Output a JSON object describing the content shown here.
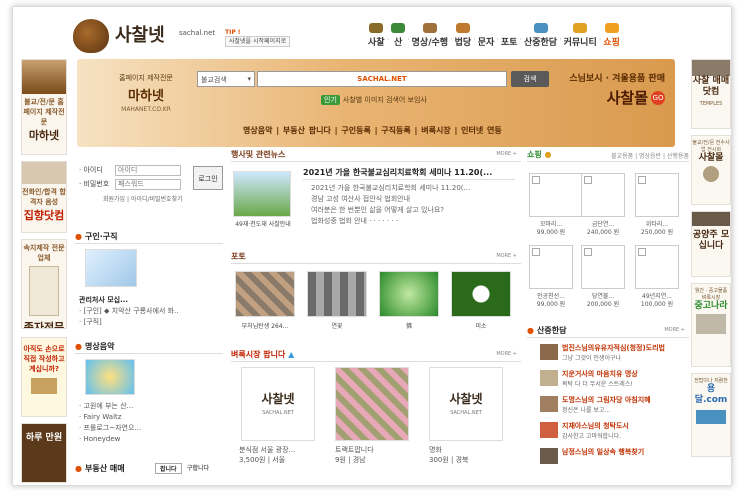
{
  "logo": {
    "name": "사찰넷",
    "domain": "sachal.net"
  },
  "tip": {
    "badge": "TIP !",
    "text": "사찰넷을 시작페이지로"
  },
  "topnav": [
    "사찰",
    "산",
    "명상/수행",
    "법당",
    "문자",
    "포토",
    "산중한담",
    "커뮤니티",
    "쇼핑"
  ],
  "banner": {
    "maha_small": "홈페이지 제작전문",
    "maha_big": "마하넷",
    "maha_domain": "MAHANET.CO.KR",
    "search_select": "불교검색",
    "search_value": "SACHAL.NET",
    "search_button": "검색",
    "popular_tag": "인기",
    "popular_text": "사찰별 이미지 검색어 보임사",
    "mall_small": "스님보시 · 겨울용품 판매",
    "mall_big": "사찰몰",
    "mall_go": "GO",
    "categories": "명상음악 | 부동산 팝니다 | 구인등록 | 구직등록 | 벼룩시장 | 인터넷 연등"
  },
  "left_ads": [
    {
      "small": "불교/전/문 홈페이지 제작전문",
      "big": "마하넷"
    },
    {
      "small": "전화인/합격 합격자 음성",
      "big": "집향닷컴"
    },
    {
      "small": "속지제작 전문업체",
      "big": "족자전문"
    },
    {
      "small": "아직도 손으로 직접 작성하고 계십니까?",
      "big": ""
    },
    {
      "small": "",
      "big": "하루 만원"
    }
  ],
  "login": {
    "id_label": "· 아이디",
    "pw_label": "· 비밀번호",
    "id_placeholder": "아이디",
    "pw_placeholder": "패스워드",
    "button": "로그인",
    "links": "회원가입 | 아이디/비밀번호찾기"
  },
  "jobs": {
    "title": "구인·구직",
    "items": [
      "관리처사 모십...",
      "· [구인] ◆ 치악산 구룡사에서 화..",
      "· [구직]"
    ]
  },
  "music": {
    "title": "명상음악",
    "items": [
      "· 고원에 부는 산...",
      "· Fairy Waltz",
      "· 프롤로그~자연으...",
      "· Honeydew"
    ]
  },
  "estate": {
    "title": "부동산 매매",
    "tab1": "팝니다",
    "tab2": "구합니다"
  },
  "news": {
    "title": "행사및 관련뉴스",
    "more": "MORE +",
    "head": "2021년 가을 한국불교심리치료학회 세미나 11.20(...",
    "caption": "49재·천도재 사찰안내",
    "body": [
      "2021년 가을 한국불교심리치료학회 세미나 11.20(...",
      "경남 고성 여산사 접안식 법회안내",
      "여러분은 한 번뿐인 삶을 어떻게 살고 있나요?",
      "법화성중 법회 안내 · · · · · · ·"
    ]
  },
  "photo": {
    "title": "포토",
    "more": "MORE +",
    "caps": [
      "부처님탄생 264...",
      "연꽃",
      "佛",
      "미소"
    ]
  },
  "market": {
    "title": "벼룩시장 팝니다",
    "more": "MORE +",
    "items": [
      {
        "big": "사찰넷",
        "small": "SACHAL.NET",
        "cap1": "분식점 서울 광장...",
        "cap2": "3,500원 | 서울"
      },
      {
        "big": "",
        "small": "",
        "cap1": "트랙트팝니다",
        "cap2": "9원 | 경남"
      },
      {
        "big": "사찰넷",
        "small": "SACHAL.NET",
        "cap1": "명화",
        "cap2": "300원 | 경북"
      }
    ]
  },
  "shop": {
    "title": "쇼핑",
    "links": "불교용품 | 명상음반 | 산행용품",
    "row1": [
      {
        "name": "꼬마리...",
        "price": "99,000 원"
      },
      {
        "name": "금단연...",
        "price": "240,000 원"
      },
      {
        "name": "위타리...",
        "price": "250,000 원"
      }
    ],
    "row2": [
      {
        "name": "인공천선...",
        "price": "99,000 원"
      },
      {
        "name": "당연불...",
        "price": "200,000 원"
      },
      {
        "name": "49년지연...",
        "price": "100,000 원"
      }
    ]
  },
  "talk": {
    "title": "산중한담",
    "more": "MORE +",
    "items": [
      {
        "a": "법진스님의유유자적심(청정)도리법",
        "b": "그냥 그것이 인생이구나"
      },
      {
        "a": "지운거사의 마음치유 명상",
        "b": "목탁 다 더 무서운 스트레스!"
      },
      {
        "a": "도명스님의 그림자당 아침지혜",
        "b": "정신은 나를 보고..."
      },
      {
        "a": "지재아스님의 청탁도시",
        "b": "감사한고 고마워합니다."
      },
      {
        "a": "남정스님의 일상속 행복찾기",
        "b": ""
      }
    ]
  },
  "right_ads": [
    {
      "small": "",
      "big": "사찰 매매닷컴",
      "sub": "TEMPLES"
    },
    {
      "small": "불교/전/문 전수사업 전시회",
      "big": "사찰몰",
      "sub": ""
    },
    {
      "small": "",
      "big": "공양주 모십니다",
      "sub": ""
    },
    {
      "small": "월간 · 중고물품 벼룩시장",
      "big": "중고나라",
      "sub": ""
    },
    {
      "small": "전탑이나 저렴한",
      "big": "용달.com",
      "sub": ""
    }
  ]
}
